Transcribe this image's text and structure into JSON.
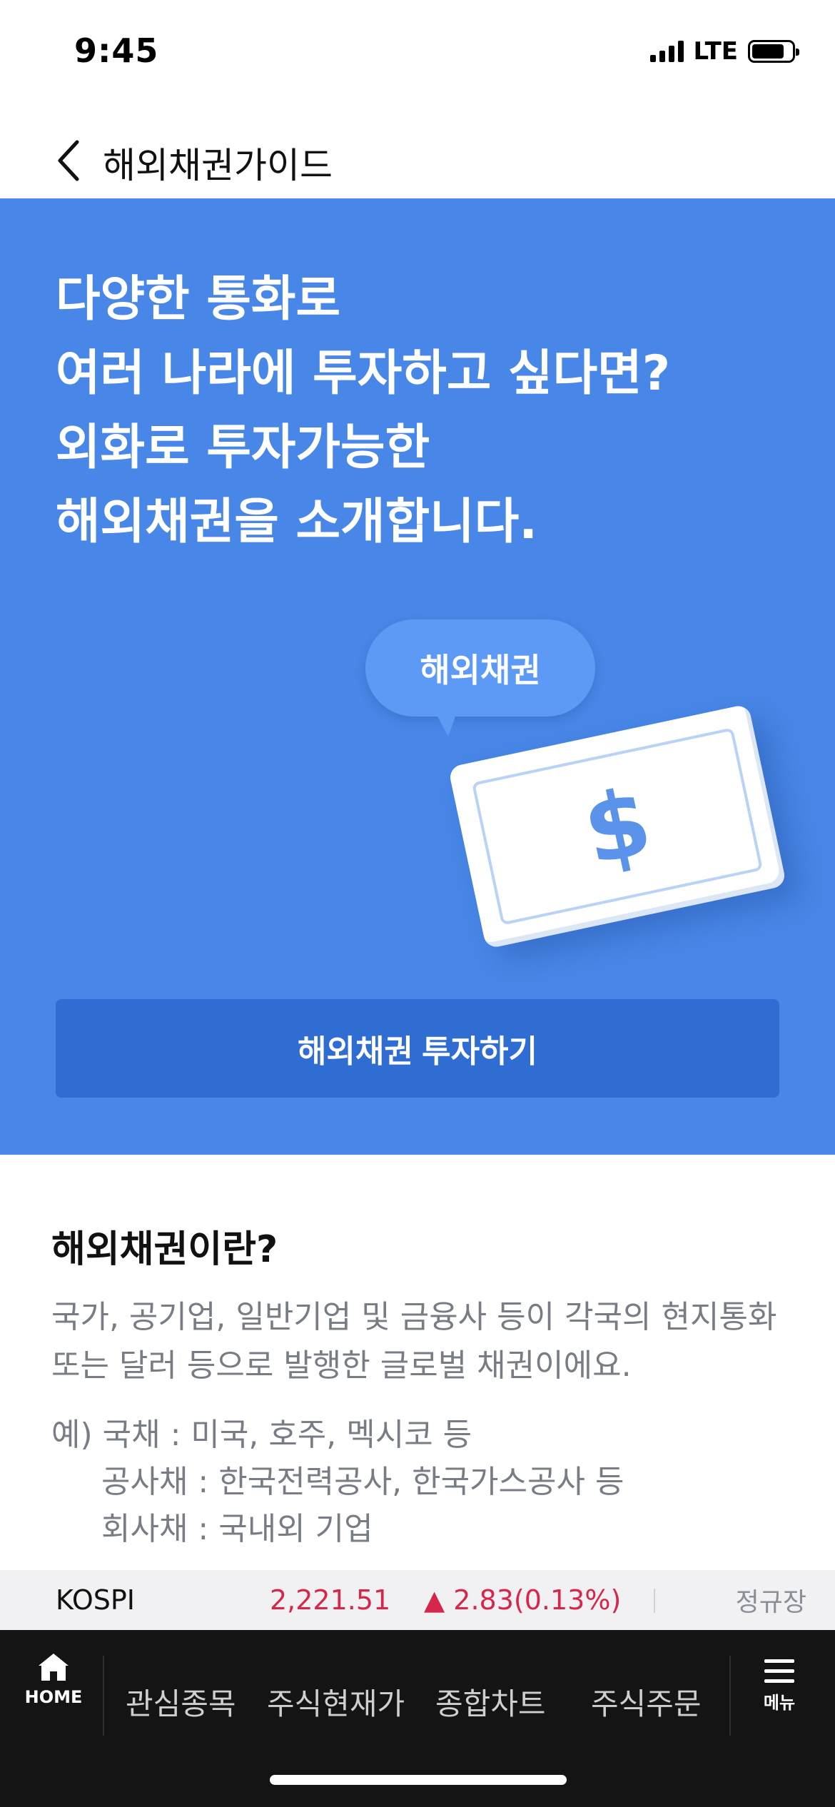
{
  "status_bar": {
    "time": "9:45",
    "network": "LTE"
  },
  "header": {
    "title": "해외채권가이드",
    "back_icon": "chevron-left-icon"
  },
  "hero": {
    "lines": [
      "다양한 통화로",
      "여러 나라에 투자하고 싶다면?",
      "외화로 투자가능한",
      "해외채권을 소개합니다."
    ],
    "bubble_label": "해외채권",
    "bill_symbol": "$",
    "cta_label": "해외채권 투자하기",
    "background_color": "#4887e7",
    "cta_color": "#2f6dd2"
  },
  "info": {
    "title": "해외채권이란?",
    "description": "국가, 공기업, 일반기업 및 금융사 등이 각국의 현지통화 또는 달러 등으로 발행한 글로벌 채권이에요.",
    "examples": [
      "예) 국채 : 미국, 호주, 멕시코 등",
      "공사채 : 한국전력공사, 한국가스공사 등",
      "회사채 : 국내외 기업"
    ]
  },
  "ticker": {
    "name": "KOSPI",
    "value": "2,221.51",
    "change": "▲ 2.83(0.13%)",
    "session": "정규장",
    "up_color": "#d6274a"
  },
  "bottom_nav": {
    "home_label": "HOME",
    "items": [
      "관심종목",
      "주식현재가",
      "종합차트",
      "주식주문"
    ],
    "menu_label": "메뉴"
  }
}
